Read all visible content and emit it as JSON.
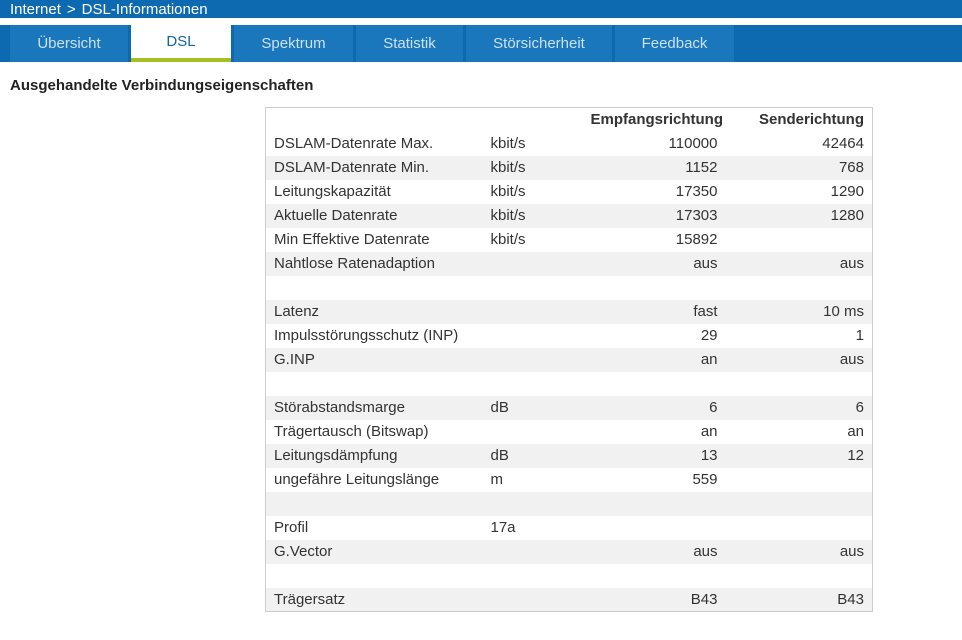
{
  "colors": {
    "brand_blue": "#0e6ab0",
    "tab_blue": "#1b77bb",
    "active_tab_text": "#15649f",
    "accent_green": "#a8bf22",
    "zebra": "#f1f1f1"
  },
  "breadcrumb": {
    "section": "Internet",
    "separator": ">",
    "page": "DSL-Informationen"
  },
  "tabs": [
    {
      "label": "Übersicht",
      "active": false
    },
    {
      "label": "DSL",
      "active": true
    },
    {
      "label": "Spektrum",
      "active": false
    },
    {
      "label": "Statistik",
      "active": false
    },
    {
      "label": "Störsicherheit",
      "active": false
    },
    {
      "label": "Feedback",
      "active": false
    }
  ],
  "title": "Ausgehandelte Verbindungseigenschaften",
  "table": {
    "col_rx": "Empfangsrichtung",
    "col_tx": "Senderichtung",
    "rows": [
      {
        "label": "DSLAM-Datenrate Max.",
        "unit": "kbit/s",
        "rx": "110000",
        "tx": "42464"
      },
      {
        "label": "DSLAM-Datenrate Min.",
        "unit": "kbit/s",
        "rx": "1152",
        "tx": "768"
      },
      {
        "label": "Leitungskapazität",
        "unit": "kbit/s",
        "rx": "17350",
        "tx": "1290"
      },
      {
        "label": "Aktuelle Datenrate",
        "unit": "kbit/s",
        "rx": "17303",
        "tx": "1280"
      },
      {
        "label": "Min Effektive Datenrate",
        "unit": "kbit/s",
        "rx": "15892",
        "tx": ""
      },
      {
        "label": "Nahtlose Ratenadaption",
        "unit": "",
        "rx": "aus",
        "tx": "aus"
      },
      {
        "label": "",
        "unit": "",
        "rx": "",
        "tx": ""
      },
      {
        "label": "Latenz",
        "unit": "",
        "rx": "fast",
        "tx": "10 ms"
      },
      {
        "label": "Impulsstörungsschutz (INP)",
        "unit": "",
        "rx": "29",
        "tx": "1"
      },
      {
        "label": "G.INP",
        "unit": "",
        "rx": "an",
        "tx": "aus"
      },
      {
        "label": "",
        "unit": "",
        "rx": "",
        "tx": ""
      },
      {
        "label": "Störabstandsmarge",
        "unit": "dB",
        "rx": "6",
        "tx": "6"
      },
      {
        "label": "Trägertausch (Bitswap)",
        "unit": "",
        "rx": "an",
        "tx": "an"
      },
      {
        "label": "Leitungsdämpfung",
        "unit": "dB",
        "rx": "13",
        "tx": "12"
      },
      {
        "label": "ungefähre Leitungslänge",
        "unit": "m",
        "rx": "559",
        "tx": ""
      },
      {
        "label": "",
        "unit": "",
        "rx": "",
        "tx": ""
      },
      {
        "label": "Profil",
        "unit": "17a",
        "rx": "",
        "tx": ""
      },
      {
        "label": "G.Vector",
        "unit": "",
        "rx": "aus",
        "tx": "aus"
      },
      {
        "label": "",
        "unit": "",
        "rx": "",
        "tx": ""
      },
      {
        "label": "Trägersatz",
        "unit": "",
        "rx": "B43",
        "tx": "B43"
      }
    ]
  }
}
